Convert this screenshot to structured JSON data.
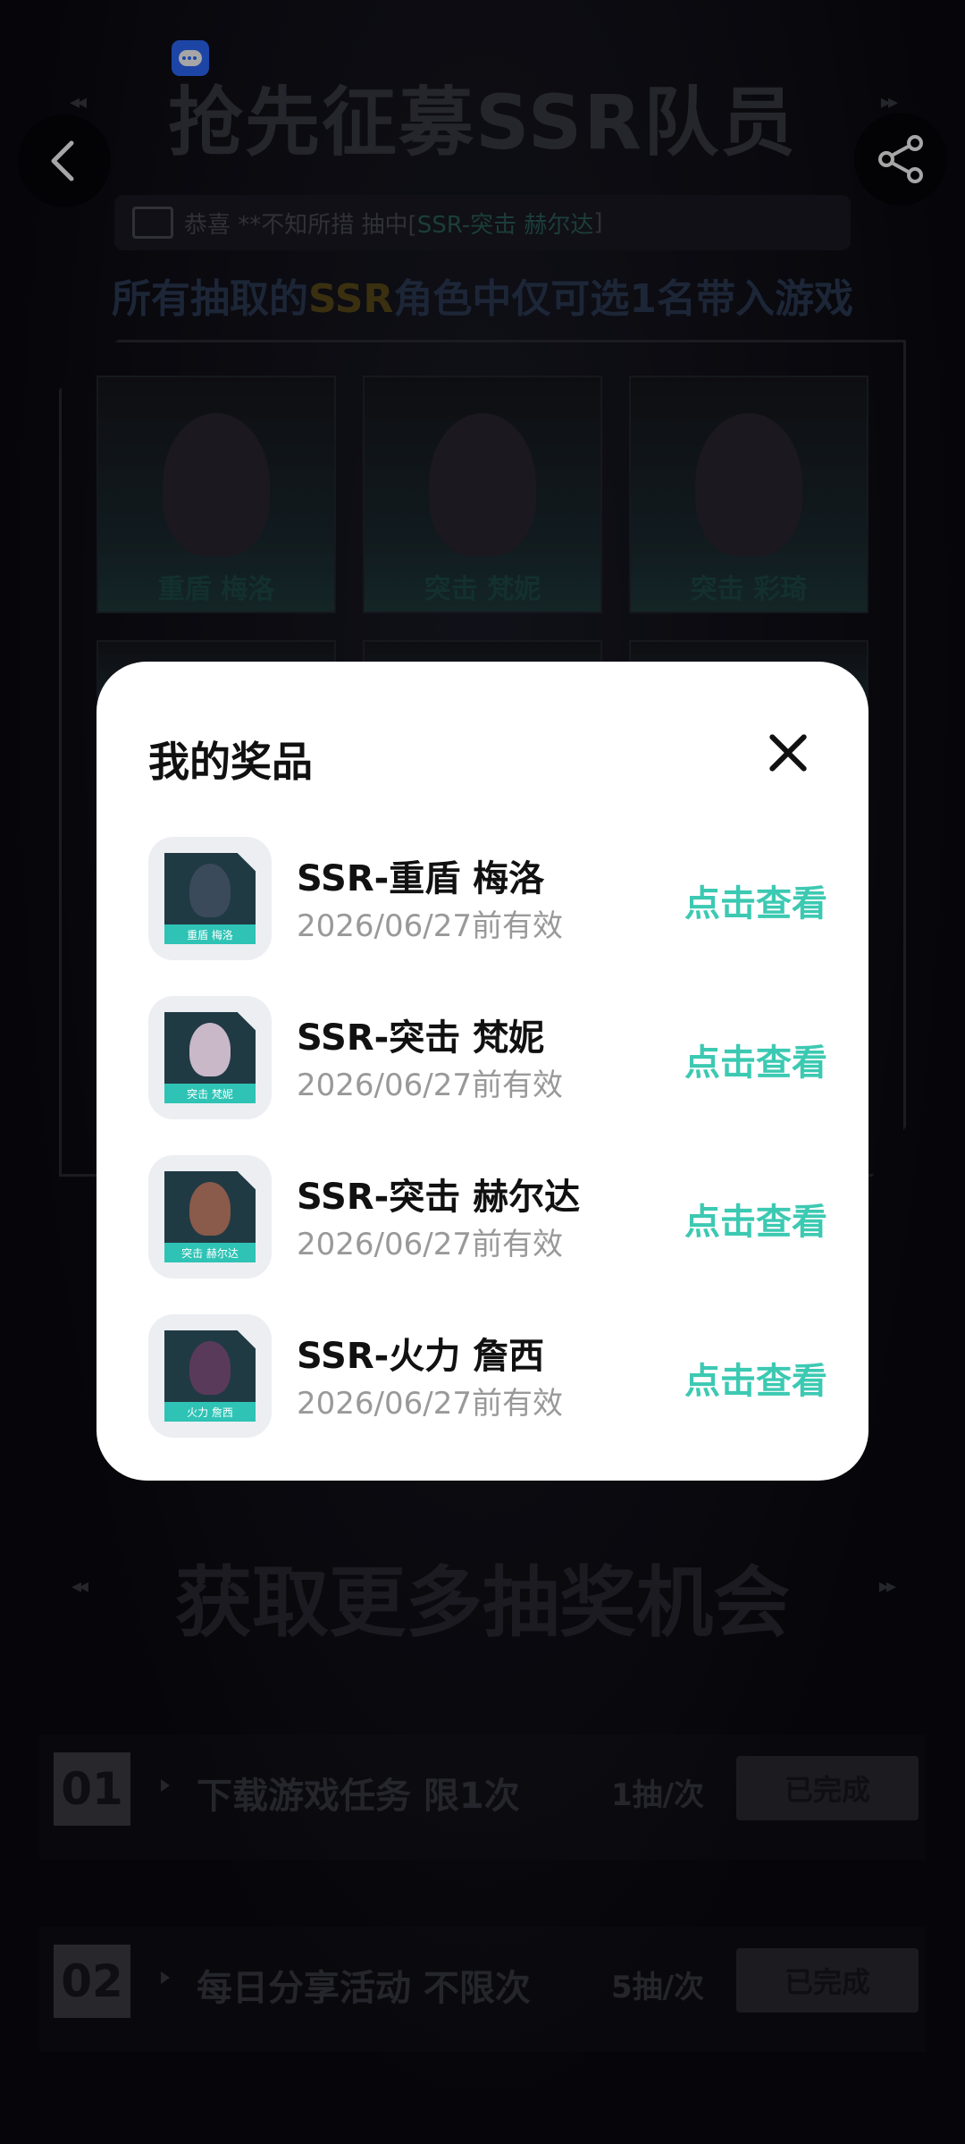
{
  "header": {
    "title": "抢先征募SSR队员",
    "notice": {
      "prefix": "恭喜 **不知所措 抽中[ ",
      "highlight": "SSR-突击 赫尔达",
      "suffix": " ]"
    },
    "subtitle_pre": "所有抽取的",
    "subtitle_ssr": "SSR",
    "subtitle_post": "角色中仅可选1名带入游戏"
  },
  "characters": [
    {
      "label": "重盾 梅洛"
    },
    {
      "label": "突击 梵妮"
    },
    {
      "label": "突击 彩琦"
    }
  ],
  "tasks_section": {
    "title": "获取更多抽奖机会"
  },
  "tasks": [
    {
      "num": "01",
      "name": "下载游戏任务 限1次",
      "count": "1抽/次",
      "status": "已完成"
    },
    {
      "num": "02",
      "name": "每日分享活动 不限次",
      "count": "5抽/次",
      "status": "已完成"
    }
  ],
  "modal": {
    "title": "我的奖品",
    "prizes": [
      {
        "name": "SSR-重盾 梅洛",
        "valid": "2026/06/27前有效",
        "action": "点击查看",
        "card_label": "重盾 梅洛",
        "face_color": "#3a4a5a"
      },
      {
        "name": "SSR-突击 梵妮",
        "valid": "2026/06/27前有效",
        "action": "点击查看",
        "card_label": "突击 梵妮",
        "face_color": "#c8b8c8"
      },
      {
        "name": "SSR-突击 赫尔达",
        "valid": "2026/06/27前有效",
        "action": "点击查看",
        "card_label": "突击 赫尔达",
        "face_color": "#8a5a4a"
      },
      {
        "name": "SSR-火力 詹西",
        "valid": "2026/06/27前有效",
        "action": "点击查看",
        "card_label": "火力 詹西",
        "face_color": "#5a3a5a"
      }
    ]
  },
  "colors": {
    "accent": "#3cc9b2",
    "modal_bg": "#ffffff"
  }
}
